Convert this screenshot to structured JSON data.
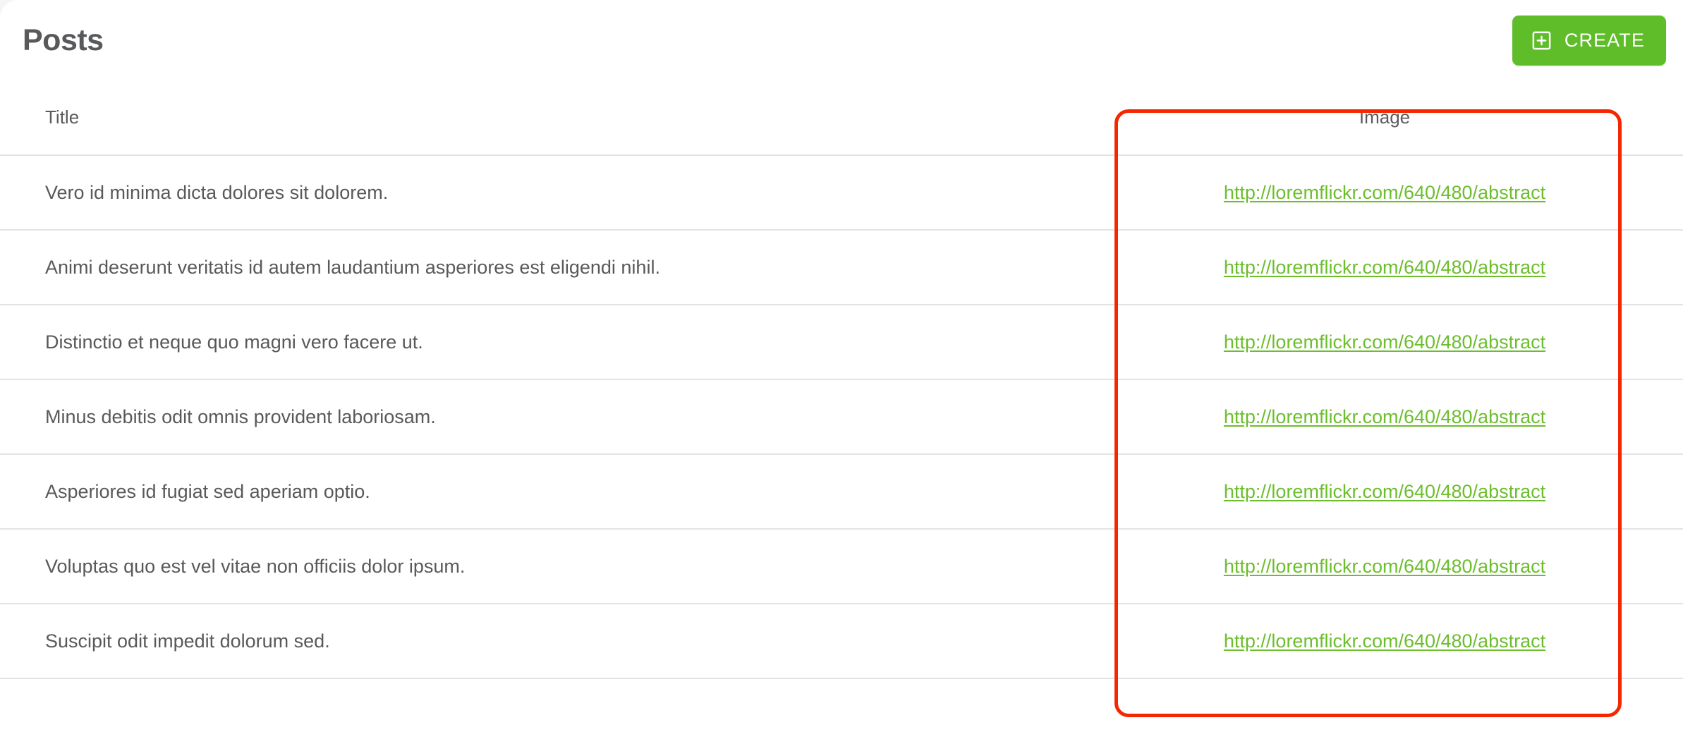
{
  "header": {
    "title": "Posts",
    "create_button": {
      "label": "CREATE",
      "icon": "plus-square-icon",
      "color": "#60bd2a"
    }
  },
  "table": {
    "columns": [
      {
        "key": "title",
        "label": "Title",
        "align": "left"
      },
      {
        "key": "image",
        "label": "Image",
        "align": "center"
      }
    ],
    "rows": [
      {
        "title": "Vero id minima dicta dolores sit dolorem.",
        "image": "http://loremflickr.com/640/480/abstract"
      },
      {
        "title": "Animi deserunt veritatis id autem laudantium asperiores est eligendi nihil.",
        "image": "http://loremflickr.com/640/480/abstract"
      },
      {
        "title": "Distinctio et neque quo magni vero facere ut.",
        "image": "http://loremflickr.com/640/480/abstract"
      },
      {
        "title": "Minus debitis odit omnis provident laboriosam.",
        "image": "http://loremflickr.com/640/480/abstract"
      },
      {
        "title": "Asperiores id fugiat sed aperiam optio.",
        "image": "http://loremflickr.com/640/480/abstract"
      },
      {
        "title": "Voluptas quo est vel vitae non officiis dolor ipsum.",
        "image": "http://loremflickr.com/640/480/abstract"
      },
      {
        "title": "Suscipit odit impedit dolorum sed.",
        "image": "http://loremflickr.com/640/480/abstract"
      }
    ]
  },
  "annotation": {
    "target_column": "Image",
    "color": "#f52700"
  },
  "colors": {
    "accent_green": "#60bd2a",
    "link_green": "#6cbe2d",
    "text_gray": "#58595b",
    "row_divider": "#e3e3e5",
    "annotation_red": "#f52700"
  }
}
